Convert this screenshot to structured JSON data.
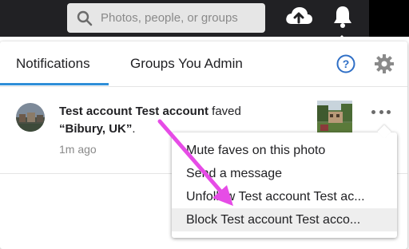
{
  "topbar": {
    "search_placeholder": "Photos, people, or groups",
    "icons": [
      "search-icon",
      "upload-cloud-icon",
      "bell-icon"
    ]
  },
  "notifications": {
    "tabs": [
      {
        "label": "Notifications",
        "active": true
      },
      {
        "label": "Groups You Admin",
        "active": false
      }
    ],
    "accent_color": "#2f8fd8",
    "items": [
      {
        "actor": "Test account Test account",
        "action": "faved",
        "photo_title": "“Bibury, UK”",
        "suffix": ".",
        "time": "1m ago"
      }
    ]
  },
  "menu": {
    "items": [
      "Mute faves on this photo",
      "Send a message",
      "Unfollow Test account Test ac...",
      "Block Test account Test acco..."
    ],
    "highlighted_index": 3
  },
  "annotation": {
    "arrow_color": "#e64ce6"
  }
}
